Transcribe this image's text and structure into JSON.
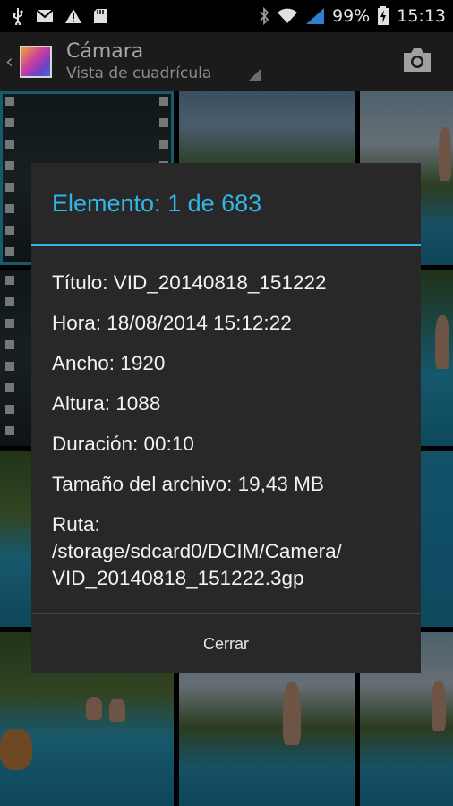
{
  "status_bar": {
    "battery_percent": "99%",
    "time": "15:13",
    "icons": [
      "usb-icon",
      "gmail-icon",
      "warning-icon",
      "sd-card-icon",
      "bluetooth-icon",
      "wifi-icon",
      "signal-icon",
      "battery-charging-icon"
    ]
  },
  "action_bar": {
    "title": "Cámara",
    "subtitle": "Vista de cuadrícula",
    "up_icon": "chevron-left-icon",
    "action_icon": "camera-icon"
  },
  "dialog": {
    "title": "Elemento: 1 de 683",
    "details": {
      "title_line": "Título: VID_20140818_151222",
      "time_line": "Hora: 18/08/2014 15:12:22",
      "width_line": "Ancho: 1920",
      "height_line": "Altura: 1088",
      "duration_line": "Duración: 00:10",
      "size_line": "Tamaño del archivo: 19,43 MB",
      "path_label": "Ruta:",
      "path_line1": "/storage/sdcard0/DCIM/Camera/",
      "path_line2": "VID_20140818_151222.3gp"
    },
    "close_label": "Cerrar"
  },
  "colors": {
    "accent": "#33b5e5",
    "dialog_bg": "#282828",
    "action_bar_bg": "#1b1b1b"
  }
}
